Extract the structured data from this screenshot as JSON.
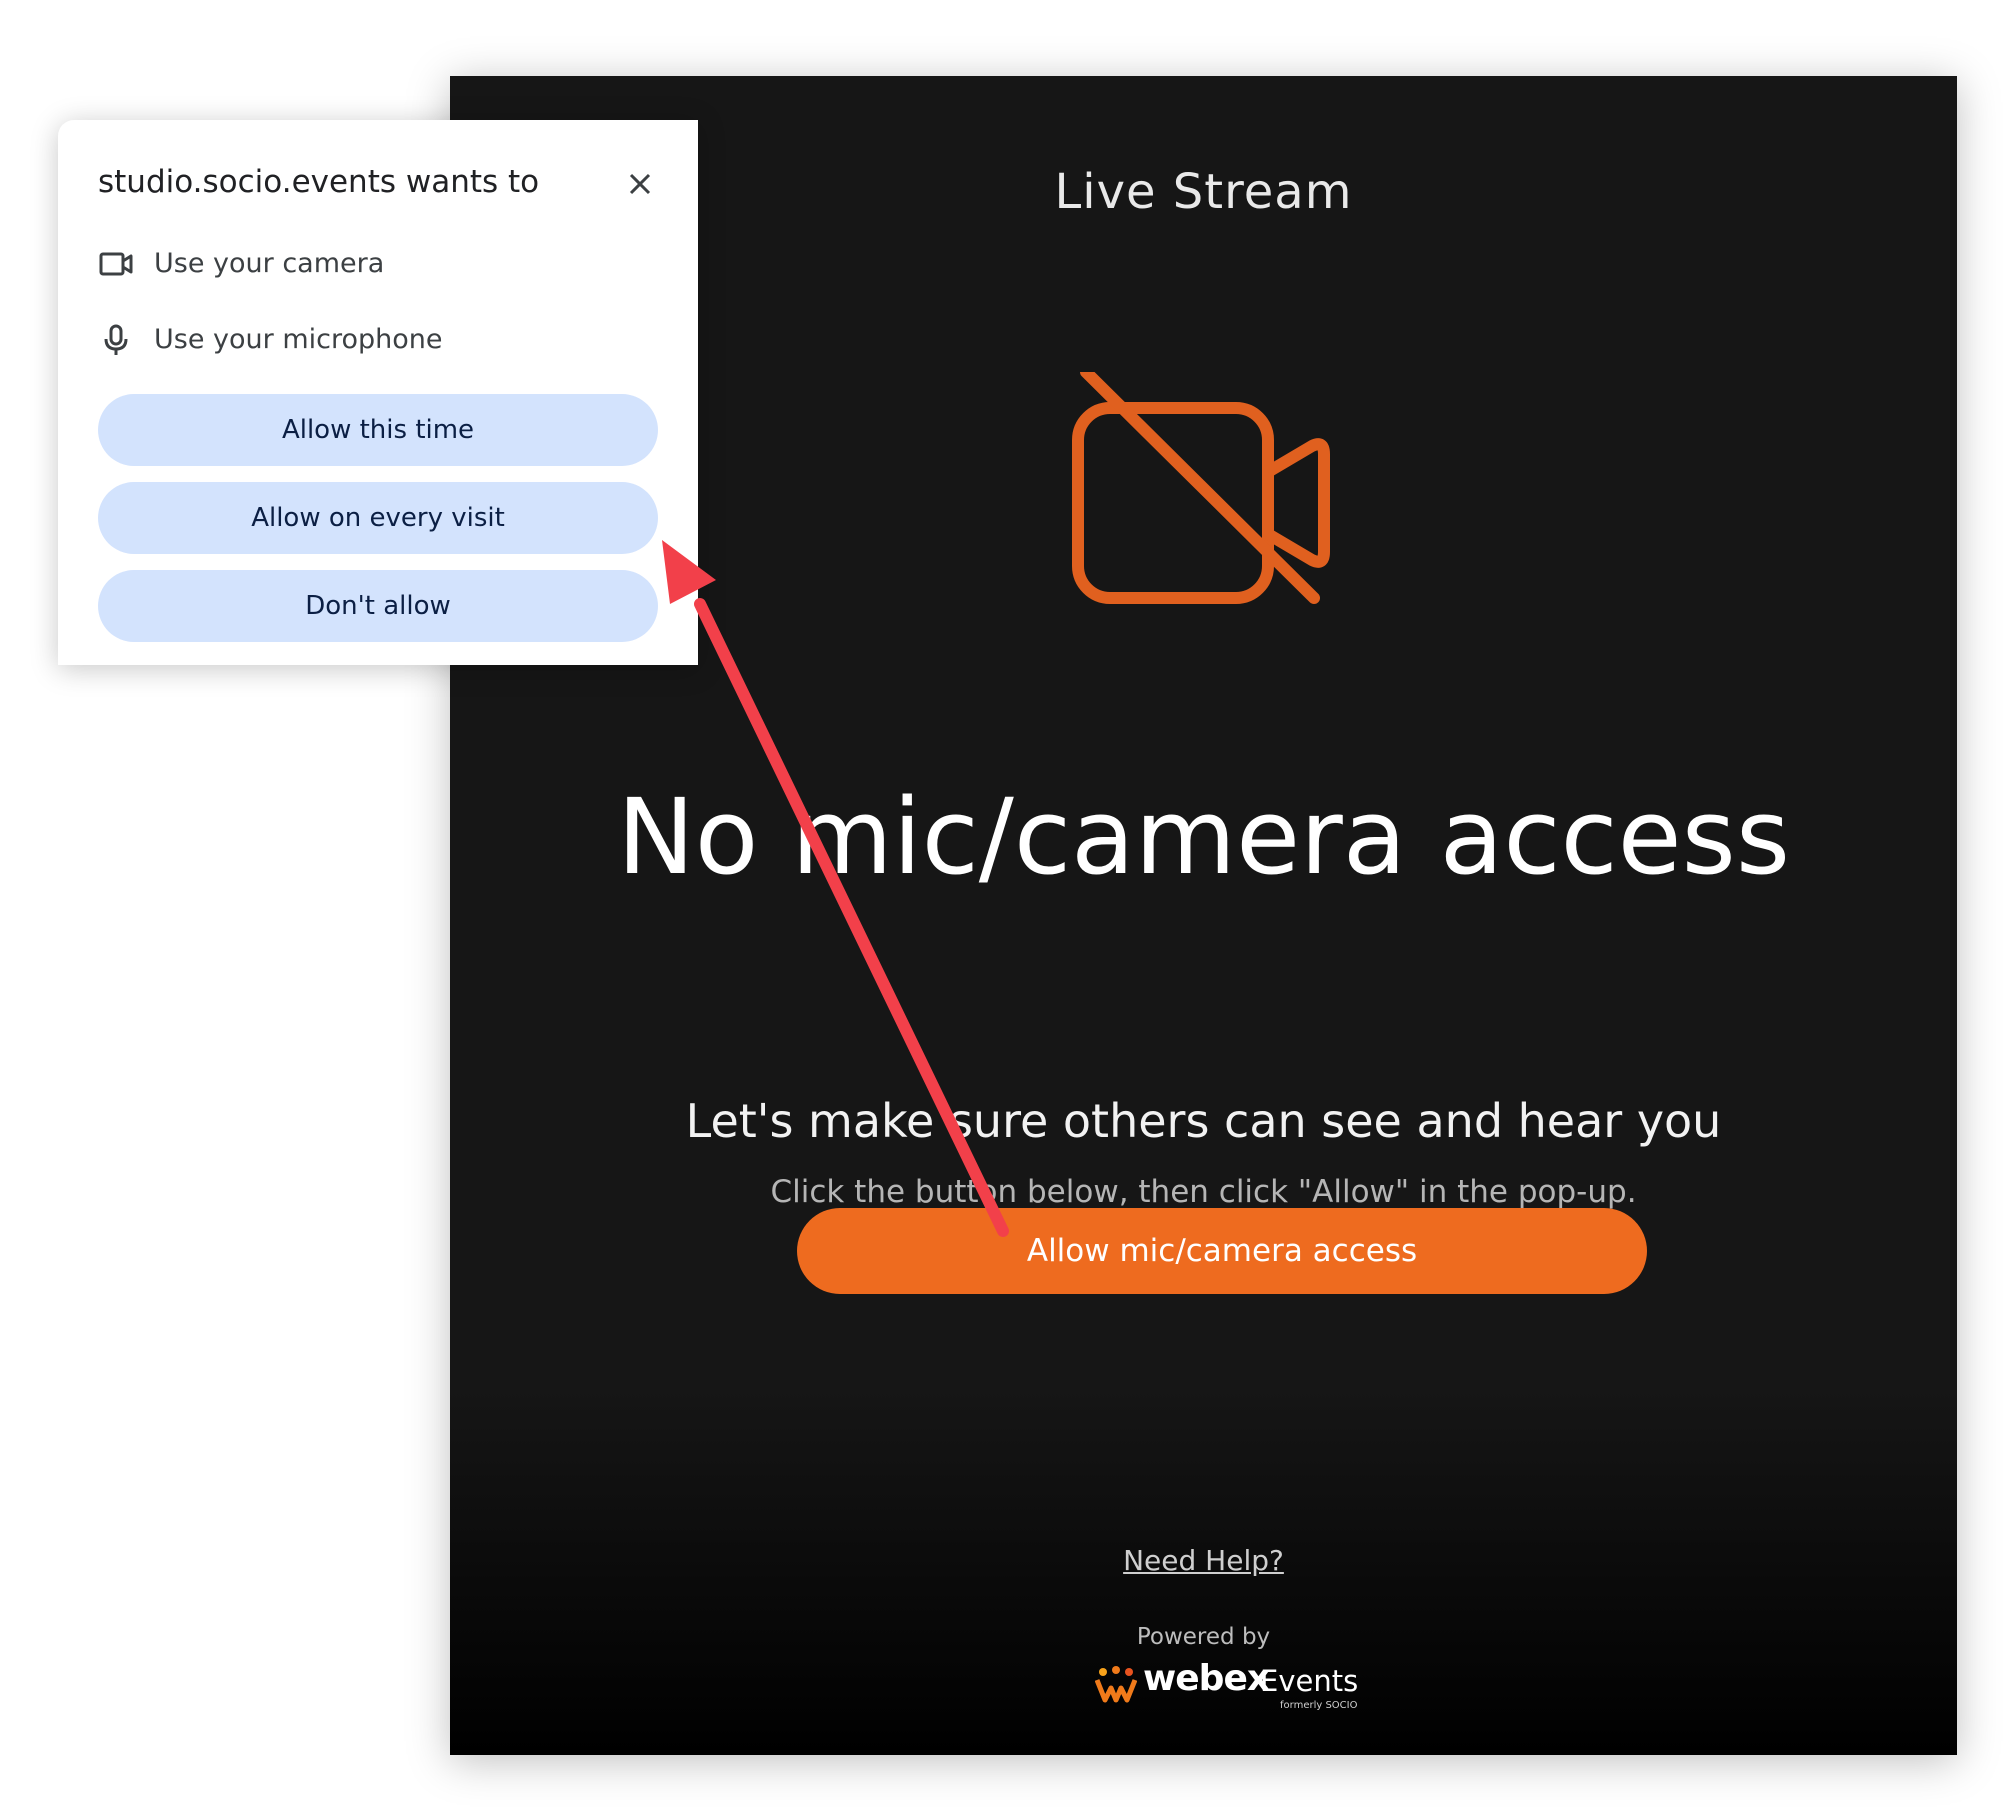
{
  "stage": {
    "title": "Live Stream",
    "headline": "No mic/camera access",
    "subline": "Let's make sure others can see and hear you",
    "instruction": "Click the button below, then click \"Allow\" in the pop-up.",
    "allow_button": "Allow mic/camera access",
    "help_link": "Need Help?",
    "powered_by": "Powered by",
    "logo": {
      "word": "webex",
      "events": "Events",
      "formerly": "formerly SOCIO"
    },
    "icon": "camera-off-icon",
    "accent_color": "#ee6b1f"
  },
  "popup": {
    "title": "studio.socio.events wants to",
    "permissions": [
      {
        "icon": "camera-icon",
        "label": "Use your camera"
      },
      {
        "icon": "microphone-icon",
        "label": "Use your microphone"
      }
    ],
    "buttons": {
      "allow_this_time": "Allow this time",
      "allow_every_visit": "Allow on every visit",
      "dont_allow": "Don't allow"
    },
    "button_color": "#d3e3fd"
  },
  "annotation": {
    "icon": "arrow-annotation-icon",
    "color": "#f2404a"
  }
}
